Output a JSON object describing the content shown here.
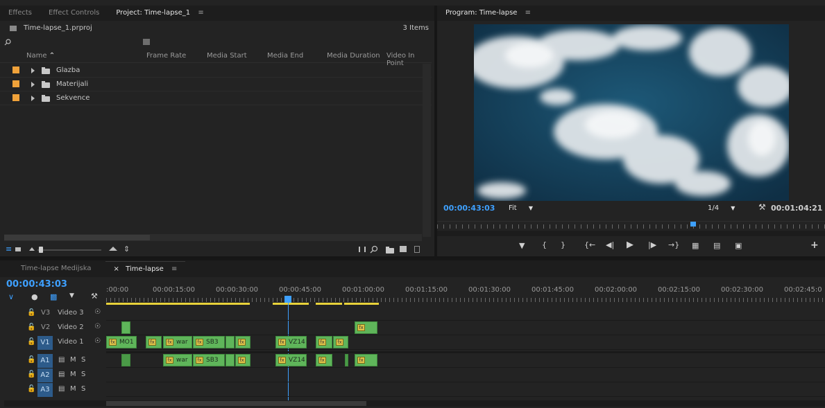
{
  "project_panel": {
    "tabs": [
      {
        "label": "Effects"
      },
      {
        "label": "Effect Controls"
      },
      {
        "label": "Project: Time-lapse_1",
        "menu": "≡"
      }
    ],
    "file_name": "Time-lapse_1.prproj",
    "item_count": "3 Items",
    "columns": [
      "Name",
      "Frame Rate",
      "Media Start",
      "Media End",
      "Media Duration",
      "Video In Point"
    ],
    "sort_indicator": "^",
    "items": [
      {
        "name": "Glazba",
        "label_color": "#f0a23a"
      },
      {
        "name": "Materijali",
        "label_color": "#f0a23a"
      },
      {
        "name": "Sekvence",
        "label_color": "#f0a23a"
      }
    ],
    "search_icon": "search-icon"
  },
  "program_monitor": {
    "tab_label": "Program: Time-lapse",
    "tab_menu": "≡",
    "timecode": "00:00:43:03",
    "fit_label": "Fit",
    "resolution": "1/4",
    "duration": "00:01:04:21",
    "playhead_fraction": 0.66
  },
  "timeline": {
    "tabs": [
      {
        "label": "Time-lapse Medijska"
      },
      {
        "label": "Time-lapse",
        "close": "×",
        "menu": "≡"
      }
    ],
    "timecode": "00:00:43:03",
    "ruler_labels": [
      ":00:00",
      "00:00:15:00",
      "00:00:30:00",
      "00:00:45:00",
      "00:01:00:00",
      "00:01:15:00",
      "00:01:30:00",
      "00:01:45:00",
      "00:02:00:00",
      "00:02:15:00",
      "00:02:30:00",
      "00:02:45:0"
    ],
    "video_tracks": [
      {
        "id": "V3",
        "name": "Video 3"
      },
      {
        "id": "V2",
        "name": "Video 2"
      },
      {
        "id": "V1",
        "name": "Video 1"
      }
    ],
    "audio_tracks": [
      {
        "id": "A1",
        "m": "M",
        "s": "S"
      },
      {
        "id": "A2",
        "m": "M",
        "s": "S"
      },
      {
        "id": "A3",
        "m": "M",
        "s": "S"
      }
    ],
    "clips_v1": [
      {
        "label": "MO1"
      },
      {
        "label": ""
      },
      {
        "label": "war"
      },
      {
        "label": "SB3"
      },
      {
        "label": ""
      },
      {
        "label": ""
      },
      {
        "label": "VZ14"
      },
      {
        "label": ""
      },
      {
        "label": ""
      }
    ],
    "clips_a1": [
      {
        "label": ""
      },
      {
        "label": "war"
      },
      {
        "label": "SB3"
      },
      {
        "label": ""
      },
      {
        "label": ""
      },
      {
        "label": "VZ14"
      },
      {
        "label": ""
      },
      {
        "label": ""
      }
    ],
    "clip_v2": {
      "label": ""
    },
    "clip_v2b": {
      "label": ""
    }
  },
  "colors": {
    "accent": "#3ea0ff",
    "clip_green": "#5fb55a",
    "label_orange": "#f0a23a",
    "workarea_yellow": "#e8d23a"
  }
}
